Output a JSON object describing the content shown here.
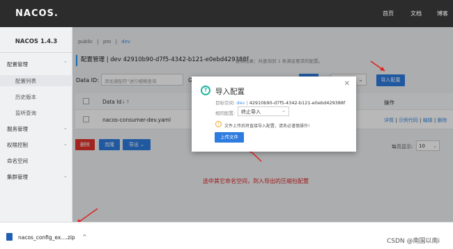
{
  "topbar": {
    "logo": "NACOS.",
    "nav": [
      "首页",
      "文档",
      "博客"
    ]
  },
  "sidebar": {
    "version": "NACOS 1.4.3",
    "items": [
      {
        "label": "配置管理",
        "sub": false,
        "chevron": "⌃"
      },
      {
        "label": "配置列表",
        "sub": true
      },
      {
        "label": "历史版本",
        "sub": true
      },
      {
        "label": "监听查询",
        "sub": true
      },
      {
        "label": "服务管理",
        "sub": false,
        "chevron": "⌄"
      },
      {
        "label": "权限控制",
        "sub": false,
        "chevron": "⌄"
      },
      {
        "label": "命名空间",
        "sub": false
      },
      {
        "label": "集群管理",
        "sub": false,
        "chevron": "⌄"
      }
    ]
  },
  "namespaces": {
    "items": [
      "public",
      "|",
      "pro",
      "|",
      "dev"
    ]
  },
  "config": {
    "title": "配置管理 | dev 42910b90-d7f5-4342-b121-e0ebd429388f",
    "hint": "查询结果：共查询到 1 条满足要求的配置。",
    "data_id_label": "Data ID:",
    "data_id_placeholder": "添加通配符\"进行模糊查询",
    "group_label": "G",
    "import_button": "导入配置"
  },
  "table": {
    "headers": [
      "Data Id",
      "操作"
    ],
    "sort_icon": "↓↑",
    "rows": [
      {
        "data_id": "nacos-consumer-dev.yaml",
        "ops": [
          "详情",
          "示例代码",
          "编辑",
          "删除"
        ]
      }
    ]
  },
  "actions": {
    "delete": "删除",
    "clone": "克隆",
    "export": "导出"
  },
  "pagination": {
    "label": "每页显示:",
    "value": "10"
  },
  "modal": {
    "title": "导入配置",
    "ns_label": "目标空间:",
    "ns_name": "dev",
    "ns_id": "42910b90-d7f5-4342-b121-e0ebd429388f",
    "same_label": "相同配置:",
    "same_value": "终止导入",
    "warning": "文件上传后将直接导入配置，请务必谨慎操作!",
    "upload_button": "上传文件"
  },
  "annotation": "选中其它命名空间，到入导出的压缩包配置",
  "download": {
    "filename": "nacos_config_ex....zip",
    "caret": "^"
  },
  "watermark": "CSDN @南国以南i",
  "colors": {
    "primary": "#2f7ce0",
    "danger": "#e0332a",
    "annotation": "#e02020"
  }
}
